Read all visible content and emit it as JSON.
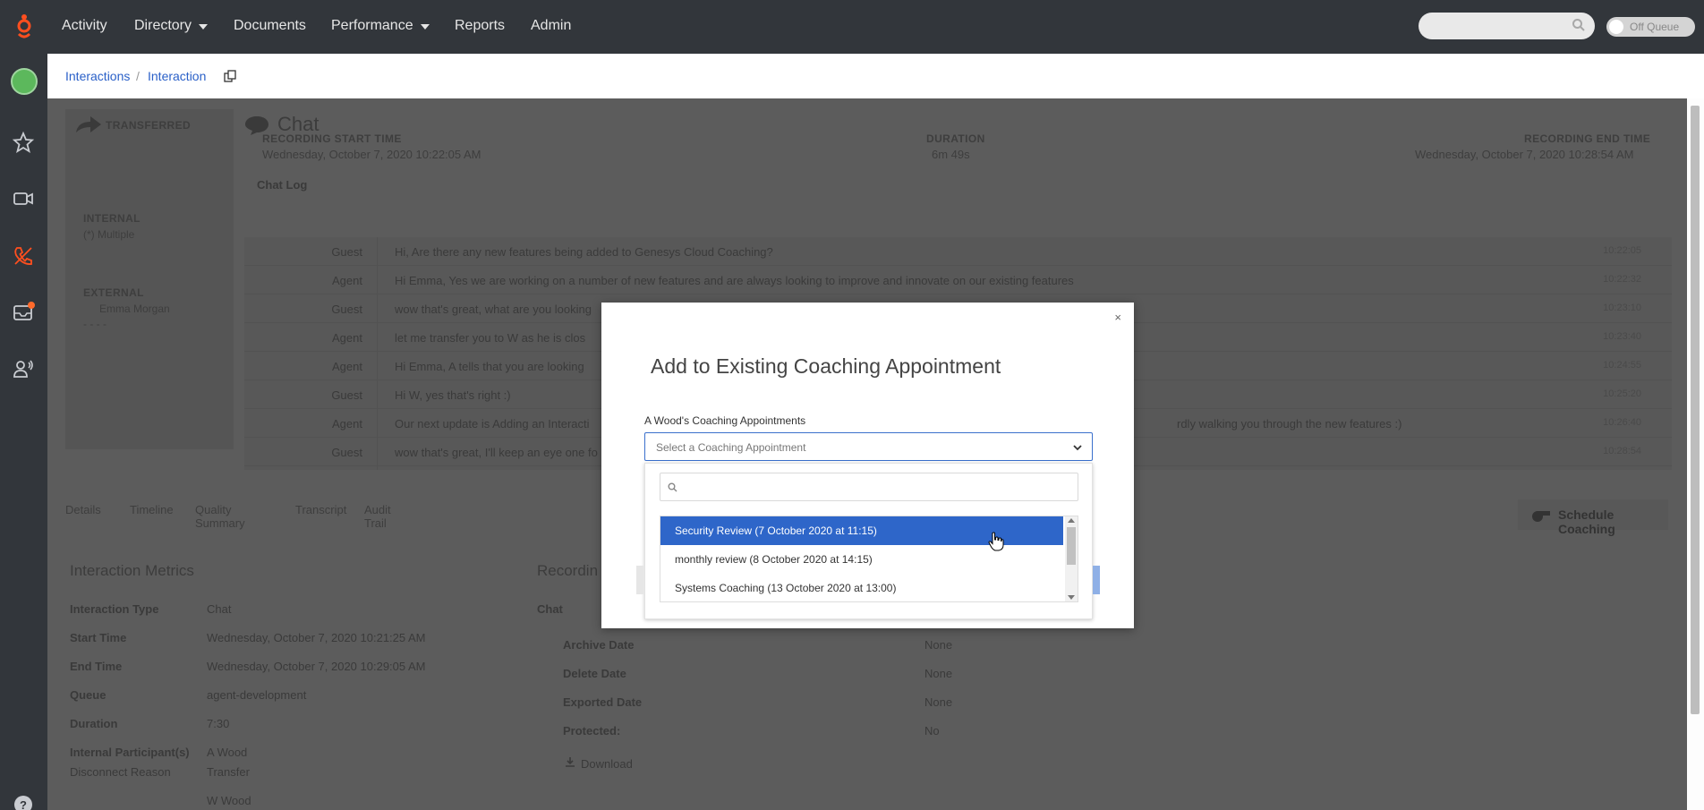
{
  "nav": {
    "items": [
      {
        "label": "Activity",
        "caret": false
      },
      {
        "label": "Directory",
        "caret": true
      },
      {
        "label": "Documents",
        "caret": false
      },
      {
        "label": "Performance",
        "caret": true
      },
      {
        "label": "Reports",
        "caret": false
      },
      {
        "label": "Admin",
        "caret": false
      }
    ],
    "search_placeholder": "",
    "status_toggle": "Off Queue"
  },
  "sidebar": {
    "icons": [
      "avatar",
      "star-icon",
      "video-icon",
      "phone-icon",
      "inbox-icon",
      "user-voice-icon",
      "help-icon"
    ]
  },
  "breadcrumb": {
    "items": [
      "Interactions",
      "Interaction"
    ],
    "separator": "/"
  },
  "interaction": {
    "status_badge": "TRANSFERRED",
    "internal_label": "INTERNAL",
    "internal_value": "(*) Multiple",
    "external_label": "EXTERNAL",
    "external_value": "Emma Morgan",
    "external_sub": "- - - -",
    "channel_title": "Chat",
    "recording_start_label": "RECORDING START TIME",
    "recording_start_value": "Wednesday, October 7, 2020 10:22:05 AM",
    "duration_label": "DURATION",
    "duration_value": "6m 49s",
    "recording_end_label": "RECORDING END TIME",
    "recording_end_value": "Wednesday, October 7, 2020 10:28:54 AM",
    "chat_log_label": "Chat Log"
  },
  "chat_log": [
    {
      "who": "Guest",
      "msg": "Hi, Are there any new features being added to Genesys Cloud Coaching?",
      "time": "10:22:05"
    },
    {
      "who": "Agent",
      "msg": "Hi Emma, Yes we are working on a number of new features and are always looking to improve and innovate on our existing features",
      "time": "10:22:32"
    },
    {
      "who": "Guest",
      "msg": "wow that's great, what are you looking",
      "time": "10:23:10"
    },
    {
      "who": "Agent",
      "msg": "let me transfer you to W as he is clos",
      "time": "10:23:40"
    },
    {
      "who": "Agent",
      "msg": "Hi Emma, A tells that you are looking",
      "time": "10:24:55"
    },
    {
      "who": "Guest",
      "msg": "Hi W, yes that's right :)",
      "time": "10:25:20"
    },
    {
      "who": "Agent",
      "msg": "Our next update is Adding an Interacti",
      "tail": "rdly walking you through the new features :)",
      "time": "10:26:40"
    },
    {
      "who": "Guest",
      "msg": "wow that's great, I'll keep an eye one fo",
      "time": "10:28:54"
    }
  ],
  "tabs": [
    "Details",
    "Timeline",
    "Quality Summary",
    "Transcript",
    "Audit Trail"
  ],
  "schedule_button": "Schedule Coaching",
  "metrics": {
    "title": "Interaction Metrics",
    "rows": [
      {
        "k": "Interaction Type",
        "v": "Chat"
      },
      {
        "k": "Start Time",
        "v": "Wednesday, October 7, 2020 10:21:25 AM"
      },
      {
        "k": "End Time",
        "v": "Wednesday, October 7, 2020 10:29:05 AM"
      },
      {
        "k": "Queue",
        "v": "agent-development"
      },
      {
        "k": "Duration",
        "v": "7:30"
      },
      {
        "k": "Internal Participant(s)",
        "v": "A Wood"
      },
      {
        "k": "Disconnect Reason",
        "v": "Transfer"
      },
      {
        "k": "",
        "v": "W Wood"
      }
    ]
  },
  "recordings": {
    "title": "Recordin",
    "sub": "Chat",
    "rows": [
      {
        "k": "Archive Date",
        "v": "None"
      },
      {
        "k": "Delete Date",
        "v": "None"
      },
      {
        "k": "Exported Date",
        "v": "None"
      },
      {
        "k": "Protected:",
        "v": "No"
      }
    ],
    "download": "Download"
  },
  "modal": {
    "title": "Add to Existing Coaching Appointment",
    "close": "×",
    "field_label": "A Wood's Coaching Appointments",
    "placeholder": "Select a Coaching Appointment",
    "options": [
      {
        "label": "Security Review (7 October 2020 at 11:15)",
        "selected": true
      },
      {
        "label": "monthly review (8 October 2020 at 14:15)",
        "selected": false
      },
      {
        "label": "Systems Coaching (13 October 2020 at 13:00)",
        "selected": false
      }
    ]
  },
  "colors": {
    "nav_bg": "#32363b",
    "accent": "#2e66c9",
    "brand": "#ff4f1f"
  }
}
